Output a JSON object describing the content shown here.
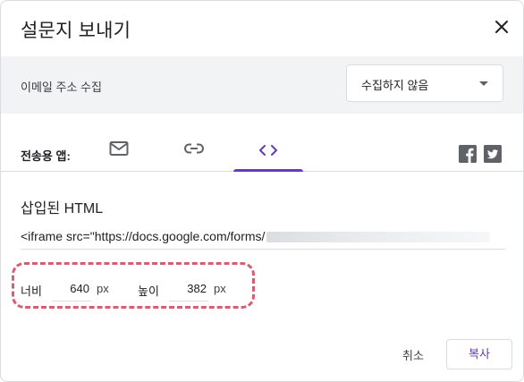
{
  "dialog": {
    "title": "설문지 보내기"
  },
  "collect_email": {
    "label": "이메일 주소 수집",
    "selected_value": "수집하지 않음"
  },
  "send_via": {
    "label": "전송용 앱:",
    "tabs": [
      {
        "icon": "email-icon"
      },
      {
        "icon": "link-icon"
      },
      {
        "icon": "code-icon",
        "active": true
      }
    ],
    "social": [
      {
        "icon": "facebook-icon"
      },
      {
        "icon": "twitter-icon"
      }
    ]
  },
  "embed": {
    "title": "삽입된 HTML",
    "code": "<iframe src=\"https://docs.google.com/forms/"
  },
  "dimensions": {
    "width_label": "너비",
    "width_value": "640",
    "width_unit": "px",
    "height_label": "높이",
    "height_value": "382",
    "height_unit": "px"
  },
  "actions": {
    "cancel": "취소",
    "copy": "복사"
  },
  "colors": {
    "accent": "#673ab7",
    "highlight": "#d25f73",
    "band": "#f1f3f4"
  }
}
